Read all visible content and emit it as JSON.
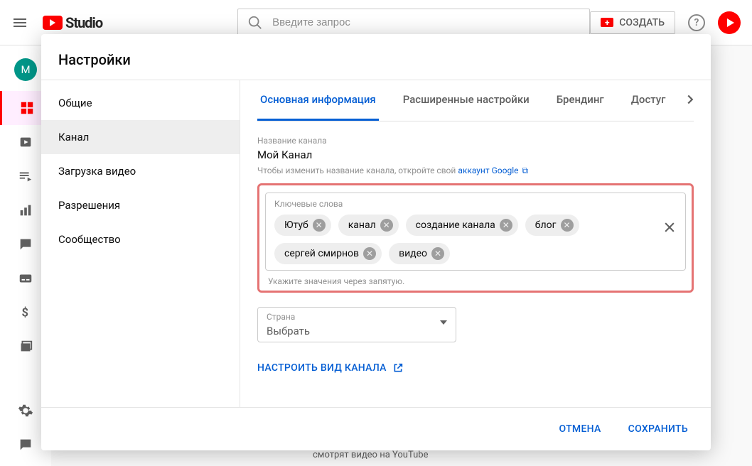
{
  "header": {
    "logo_text": "Studio",
    "search_placeholder": "Введите запрос",
    "create_label": "СОЗДАТЬ",
    "avatar_letter": "М"
  },
  "modal": {
    "title": "Настройки",
    "sidebar": {
      "items": [
        {
          "label": "Общие"
        },
        {
          "label": "Канал"
        },
        {
          "label": "Загрузка видео"
        },
        {
          "label": "Разрешения"
        },
        {
          "label": "Сообщество"
        }
      ]
    },
    "tabs": [
      {
        "label": "Основная информация"
      },
      {
        "label": "Расширенные настройки"
      },
      {
        "label": "Брендинг"
      },
      {
        "label": "Достуг"
      }
    ],
    "channel_name_label": "Название канала",
    "channel_name_value": "Мой Канал",
    "channel_name_hint_prefix": "Чтобы изменить название канала, откройте свой ",
    "channel_name_hint_link": "аккаунт Google",
    "keywords_label": "Ключевые слова",
    "keywords": [
      "Ютуб",
      "канал",
      "создание канала",
      "блог",
      "сергей смирнов",
      "видео"
    ],
    "keywords_helper": "Укажите значения через запятую.",
    "country_label": "Страна",
    "country_value": "Выбрать",
    "configure_link": "НАСТРОИТЬ ВИД КАНАЛА",
    "footer": {
      "cancel": "ОТМЕНА",
      "save": "СОХРАНИТЬ"
    }
  },
  "background_hint": "смотрят видео на YouTube"
}
